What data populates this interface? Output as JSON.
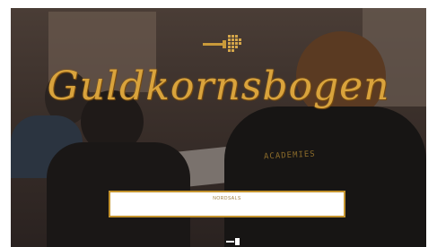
{
  "hero": {
    "title": "Guldkornsbogen",
    "shirt_text": "ACADEMIES"
  },
  "login": {
    "label": "NORDSALS"
  },
  "colors": {
    "gold": "#d9a33c",
    "box_border": "#c4942f"
  },
  "icons": [
    "gold-key-logo",
    "footer-logo"
  ]
}
